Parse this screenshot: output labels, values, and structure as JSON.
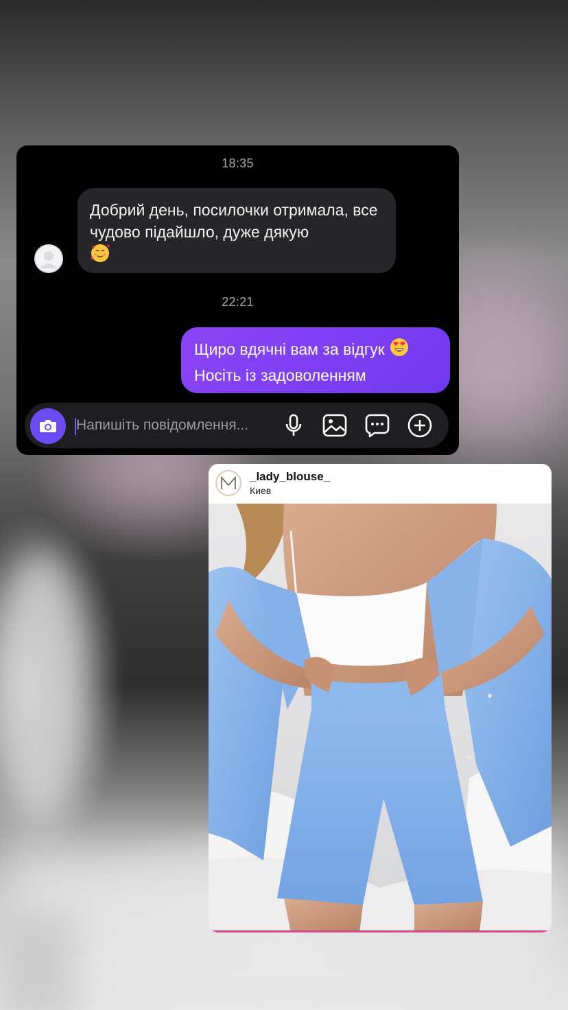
{
  "chat": {
    "received_time": "18:35",
    "received_message": "Добрий день, посилочки отримала, все чудово підайшло, дуже дякую",
    "received_emoji": "smiling-face-with-hearts-emoji",
    "sent_time": "22:21",
    "sent_line1": "Щиро вдячні вам за відгук",
    "sent_emoji": "heart-eyes-emoji",
    "sent_line2": "Носіть із задоволенням",
    "composer_placeholder": "Напишіть повідомлення...",
    "icons": [
      "camera-icon",
      "microphone-icon",
      "gallery-icon",
      "sticker-icon",
      "plus-icon"
    ],
    "colors": {
      "sent_bubble": "#7f3cf5",
      "received_bubble": "#262628",
      "camera_button": "#6b4cf2"
    }
  },
  "post": {
    "username": "_lady_blouse_",
    "location": "Киев",
    "avatar_letter": "M",
    "image": "woman-in-blue-linen-shirt-and-shorts-with-white-crop-top-photo"
  }
}
